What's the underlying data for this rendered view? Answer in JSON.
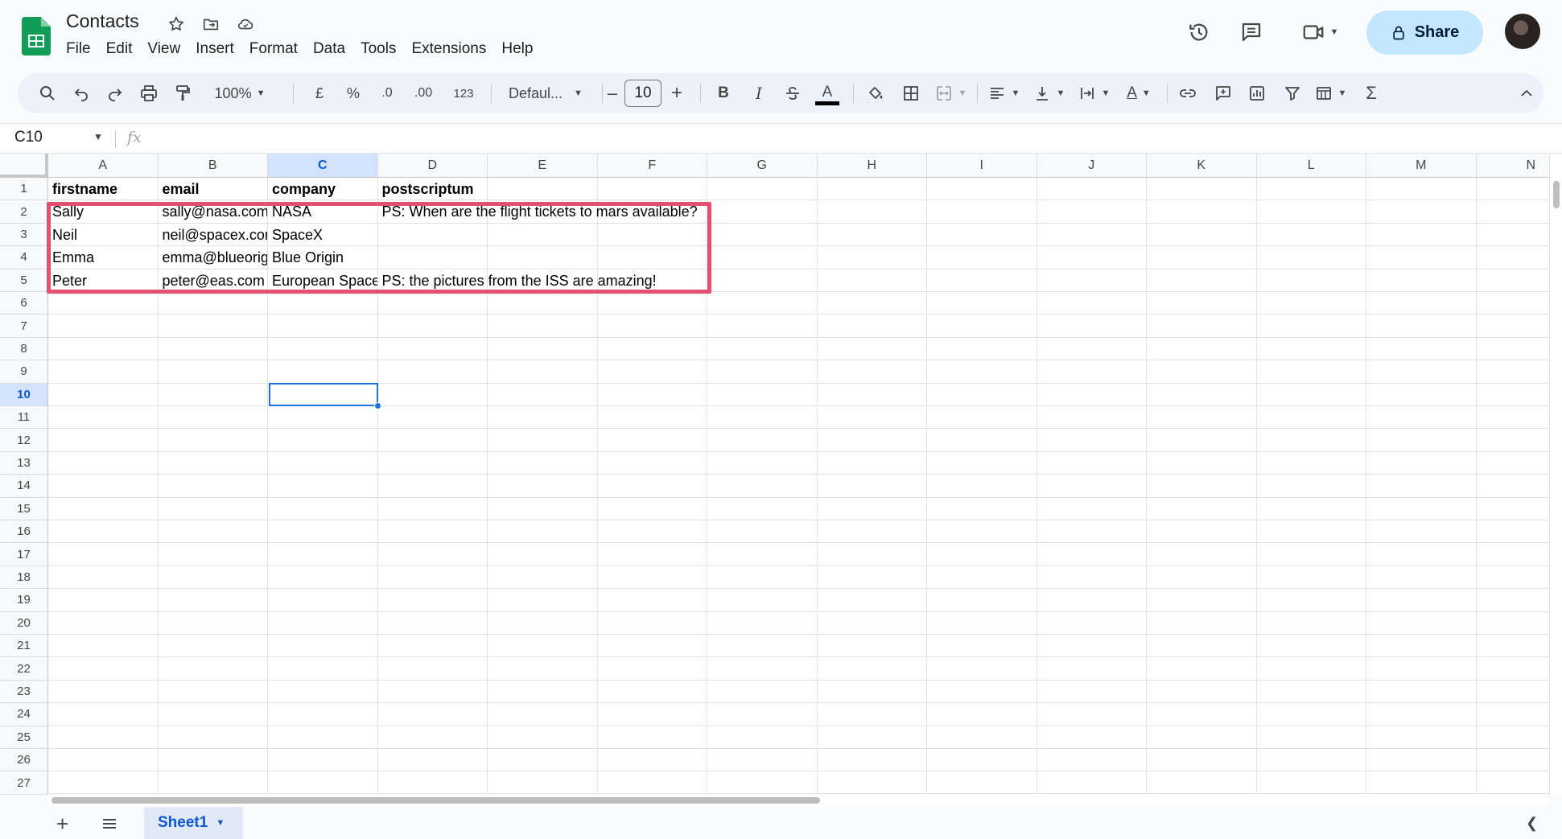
{
  "app": {
    "doc_title": "Contacts",
    "menu": [
      "File",
      "Edit",
      "View",
      "Insert",
      "Format",
      "Data",
      "Tools",
      "Extensions",
      "Help"
    ],
    "share_label": "Share",
    "accent_color": "#c2e7ff",
    "highlight_color": "#e2516f"
  },
  "toolbar": {
    "zoom": "100%",
    "currency": "£",
    "percent": "%",
    "decrease_decimal": ".0",
    "increase_decimal": ".00",
    "number_format": "123",
    "font_family": "Defaul...",
    "font_size": "10",
    "bold": "B",
    "italic": "I",
    "font_color_letter": "A",
    "text_color_letter": "A",
    "sum": "Σ"
  },
  "formula_bar": {
    "name_box": "C10",
    "fx": "fx"
  },
  "grid": {
    "columns": [
      "A",
      "B",
      "C",
      "D",
      "E",
      "F",
      "G",
      "H",
      "I",
      "J",
      "K",
      "L",
      "M",
      "N"
    ],
    "selected_column": "C",
    "rows": [
      "1",
      "2",
      "3",
      "4",
      "5",
      "6",
      "7",
      "8",
      "9",
      "10",
      "11",
      "12",
      "13",
      "14",
      "15",
      "16",
      "17",
      "18",
      "19",
      "20",
      "21",
      "22",
      "23",
      "24",
      "25",
      "26",
      "27"
    ],
    "selected_row": "10",
    "active_cell": "C10",
    "header": [
      "firstname",
      "email",
      "company",
      "postscriptum"
    ],
    "data": [
      [
        "Sally",
        "sally@nasa.com",
        "NASA",
        "PS: When are the flight tickets to mars available?"
      ],
      [
        "Neil",
        "neil@spacex.com",
        "SpaceX",
        ""
      ],
      [
        "Emma",
        "emma@blueorigin.com",
        "Blue Origin",
        ""
      ],
      [
        "Peter",
        "peter@eas.com",
        "European Space Agency",
        "PS: the pictures from the ISS are amazing!"
      ]
    ]
  },
  "sheets": {
    "tabs": [
      "Sheet1"
    ],
    "active": "Sheet1"
  },
  "icons": {
    "logo": "google-sheets-logo",
    "star": "star-icon",
    "move": "folder-move-icon",
    "cloud": "cloud-status-icon",
    "history": "version-history-icon",
    "comments": "comments-icon",
    "meet": "video-call-icon",
    "lock": "lock-icon"
  }
}
